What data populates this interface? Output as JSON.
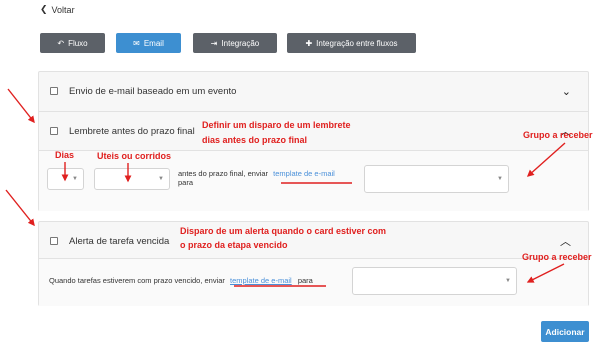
{
  "nav": {
    "back_label": "Voltar"
  },
  "toolbar": {
    "flow_label": "Fluxo",
    "email_label": "Email",
    "integration_label": "Integração",
    "integration_flows_label": "Integração entre fluxos"
  },
  "sections": {
    "event": {
      "title": "Envio de e-mail baseado em um evento"
    },
    "reminder": {
      "title": "Lembrete antes do prazo final",
      "text_before": "antes do prazo final, enviar",
      "text_after": "para",
      "template_link": "template de e-mail"
    },
    "overdue": {
      "title": "Alerta de tarefa vencida",
      "text_before": "Quando tarefas estiverem com prazo vencido, enviar",
      "template_link": "template de e-mail",
      "text_after": "para"
    }
  },
  "actions": {
    "add_label": "Adicionar"
  },
  "annotations": {
    "reminder_note": "Definir um disparo de um lembrete dias antes do prazo final",
    "days": "Dias",
    "business_or_calendar": "Uteis ou corridos",
    "group_receive_1": "Grupo a receber",
    "overdue_note": "Disparo de um alerta quando o card estiver com o prazo da etapa vencido",
    "group_receive_2": "Grupo a receber"
  },
  "colors": {
    "primary": "#3d8fd1",
    "secondary_button": "#5c6168",
    "annotation": "#e0201f",
    "link": "#4a90d9"
  },
  "icons": {
    "back": "chevron-left-icon",
    "flow": "undo-arrow-icon",
    "email": "envelope-icon",
    "integration": "export-icon",
    "integration_flows": "plus-icon",
    "collapse": "chevron-up-icon",
    "expand": "chevron-down-icon"
  }
}
